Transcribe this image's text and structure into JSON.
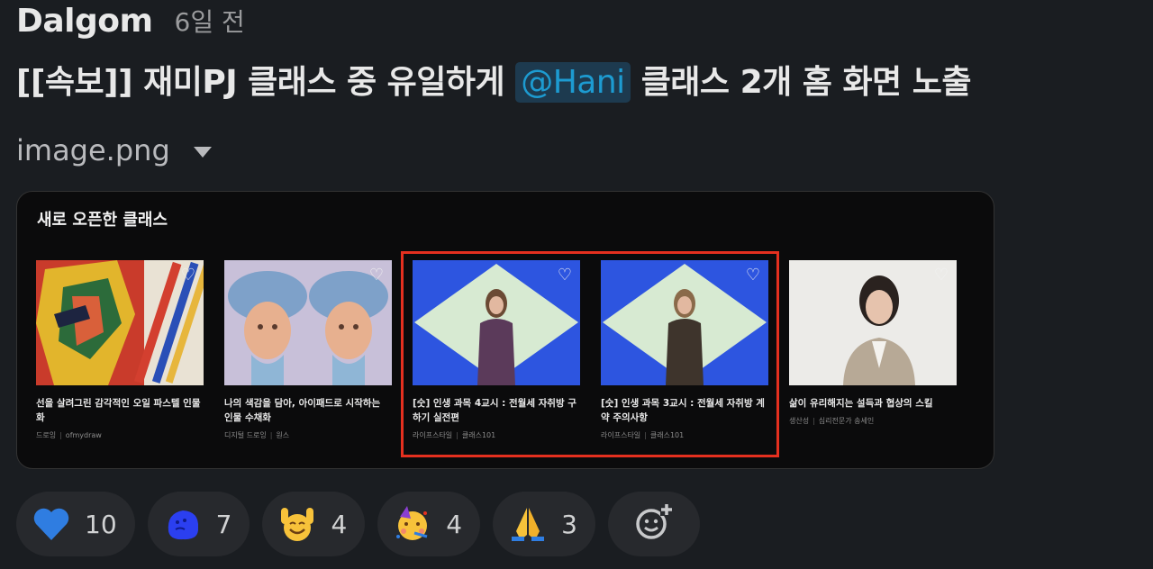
{
  "message": {
    "author": "Dalgom",
    "timestamp": "6일 전",
    "text_before": "[[속보]] 재미PJ 클래스 중 유일하게 ",
    "mention": "@Hani",
    "text_after": " 클래스 2개 홈 화면 노출"
  },
  "attachment": {
    "filename": "image.png",
    "caret_icon": "chevron-down-icon"
  },
  "preview": {
    "title": "새로 오픈한 클래스",
    "cards": [
      {
        "title": "선을 살려그린 감각적인 오일 파스텔 인물화",
        "category": "드로잉",
        "creator": "ofmydraw"
      },
      {
        "title": "나의 색감을 담아, 아이패드로 시작하는 인물 수채화",
        "category": "디지털 드로잉",
        "creator": "원스"
      },
      {
        "title": "[숫] 인생 과목 4교시 : 전월세 자취방 구하기 실전편",
        "category": "라이프스타일",
        "creator": "클래스101"
      },
      {
        "title": "[숫] 인생 과목 3교시 : 전월세 자취방 계약 주의사항",
        "category": "라이프스타일",
        "creator": "클래스101"
      },
      {
        "title": "삶이 유리해지는 설득과 협상의 스킬",
        "category": "생산성",
        "creator": "심리전문가 송세인"
      }
    ],
    "highlight_color": "#e5301f"
  },
  "reactions": [
    {
      "icon": "blue-heart-icon",
      "count": "10"
    },
    {
      "icon": "blue-blob-emoji-icon",
      "count": "7"
    },
    {
      "icon": "raised-hands-face-icon",
      "count": "4"
    },
    {
      "icon": "partying-face-icon",
      "count": "4"
    },
    {
      "icon": "folded-hands-icon",
      "count": "3"
    }
  ],
  "add_reaction_icon": "add-reaction-icon"
}
